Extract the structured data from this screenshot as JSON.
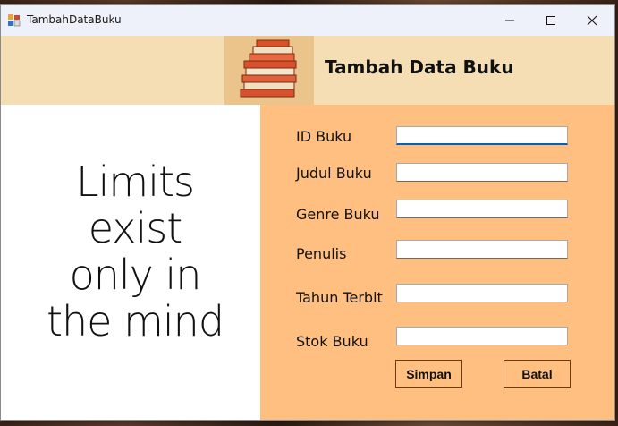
{
  "window": {
    "title": "TambahDataBuku"
  },
  "header": {
    "title": "Tambah Data Buku"
  },
  "poster": {
    "lines": [
      "Limits",
      "exist",
      "only in",
      "the mind"
    ]
  },
  "form": {
    "fields": [
      {
        "label": "ID Buku",
        "value": ""
      },
      {
        "label": "Judul Buku",
        "value": ""
      },
      {
        "label": "Genre Buku",
        "value": ""
      },
      {
        "label": "Penulis",
        "value": ""
      },
      {
        "label": "Tahun Terbit",
        "value": ""
      },
      {
        "label": "Stok Buku",
        "value": ""
      }
    ],
    "buttons": {
      "save": "Simpan",
      "cancel": "Batal"
    }
  },
  "icons": {
    "app": "app-form-icon",
    "minimize": "minimize-icon",
    "maximize": "maximize-icon",
    "close": "close-icon",
    "header": "book-stack-icon"
  },
  "colors": {
    "header_bg": "#f5deb3",
    "books_bg": "#ebc48b",
    "form_bg": "#ffbf80",
    "titlebar_bg": "#eef1f9"
  }
}
